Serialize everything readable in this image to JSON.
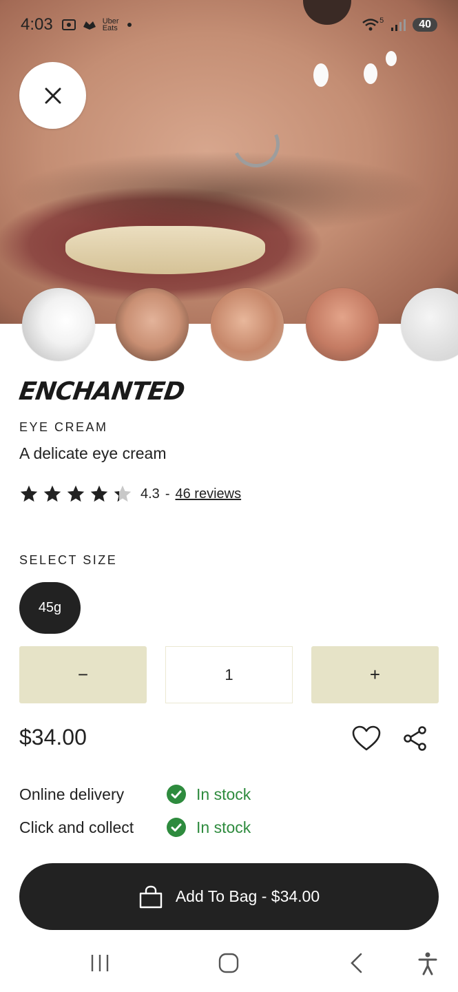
{
  "status_bar": {
    "time": "4:03",
    "app_indicator": "Uber Eats",
    "battery": "40",
    "network": "5"
  },
  "product": {
    "brand": "ENCHANTED",
    "category": "EYE CREAM",
    "description": "A delicate eye cream",
    "rating": "4.3",
    "rating_value": 4.3,
    "rating_separator": "-",
    "reviews_link": "46 reviews"
  },
  "size": {
    "label": "SELECT SIZE",
    "options": [
      "45g"
    ],
    "selected": "45g"
  },
  "quantity": {
    "minus_label": "−",
    "value": "1",
    "plus_label": "+"
  },
  "price": "$34.00",
  "availability": [
    {
      "channel": "Online delivery",
      "status": "In stock"
    },
    {
      "channel": "Click and collect",
      "status": "In stock"
    }
  ],
  "cart_button": {
    "label": "Add To Bag - $34.00"
  },
  "colors": {
    "accent_dark": "#222222",
    "stepper_bg": "#e6e3c7",
    "in_stock": "#2e8b3e"
  },
  "icons": [
    "close-icon",
    "heart-icon",
    "share-icon",
    "check-circle-icon",
    "shopping-bag-icon",
    "recent-apps-icon",
    "home-icon",
    "back-icon",
    "accessibility-icon"
  ]
}
